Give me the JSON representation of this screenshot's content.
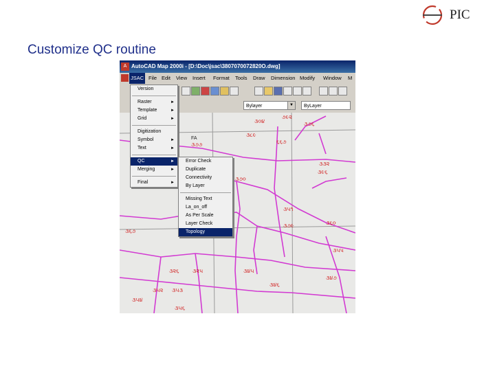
{
  "slide": {
    "brand": "PIC",
    "title": "Customize QC routine"
  },
  "window": {
    "title": "AutoCAD Map 2000i - [D:\\Doc\\jsac\\3807070072820O.dwg]"
  },
  "menubar": {
    "items": [
      "JSAC",
      "File",
      "Edit",
      "View",
      "Insert",
      "Format",
      "Tools",
      "Draw",
      "Dimension",
      "Modify",
      "Window",
      "M"
    ],
    "active_index": 0
  },
  "toolbar": {
    "layer_combo": "Bylayer",
    "linetype_combo": "ByLayer"
  },
  "jsac_menu": {
    "items": [
      {
        "label": "Version",
        "submenu": false
      },
      {
        "label": "Raster",
        "submenu": true
      },
      {
        "label": "Template",
        "submenu": true
      },
      {
        "label": "Grid",
        "submenu": true
      },
      {
        "label": "Digitization",
        "submenu": false
      },
      {
        "label": "Symbol",
        "submenu": true
      },
      {
        "label": "Text",
        "submenu": true
      },
      {
        "label": "QC",
        "submenu": true
      },
      {
        "label": "Merging",
        "submenu": true
      },
      {
        "label": "Final",
        "submenu": true
      }
    ],
    "selected": "QC"
  },
  "qc_submenu": {
    "items": [
      "Error Check",
      "Duplicate",
      "Connectivity",
      "By Layer",
      "Missing Text",
      "La_on_off",
      "As Per Scale",
      "Layer Check",
      "Topology"
    ],
    "selected": "Topology"
  },
  "map_labels": [
    "૩૦૪",
    "૭૯૨",
    "૩૮૯",
    "૩૭૬",
    "૩૭૭",
    "FA",
    "૬૬૭",
    "૩૯૬",
    "૩૭૦",
    "૩૭૯",
    "૩૬૭",
    "૩૬૦",
    "૩૨૬",
    "૩૨૫",
    "૩૪૫",
    "૩૪૬",
    "૩૪૭",
    "૩૫૨",
    "૩૫૩",
    "૩૫૪",
    "૩૫૬",
    "૩૩૨",
    "૩૫૧",
    "૩૫૫"
  ],
  "colors": {
    "parcel_lines": "#d23ad2",
    "labels": "#d01a1a",
    "title_blue": "#1f2f8a",
    "menu_highlight": "#0a246a"
  }
}
